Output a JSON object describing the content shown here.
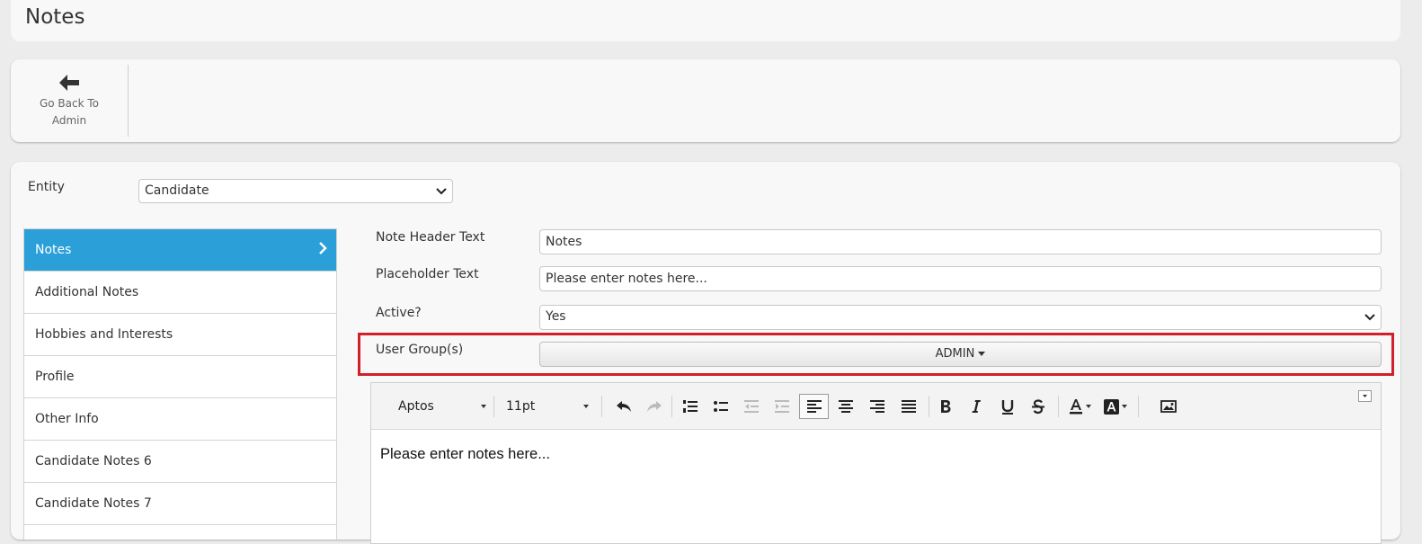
{
  "page": {
    "title": "Notes"
  },
  "toolbar": {
    "back_label": "Go Back To Admin"
  },
  "entity": {
    "label": "Entity",
    "selected": "Candidate"
  },
  "sidebar": {
    "items": [
      {
        "label": "Notes",
        "active": true
      },
      {
        "label": "Additional Notes"
      },
      {
        "label": "Hobbies and Interests"
      },
      {
        "label": "Profile"
      },
      {
        "label": "Other Info"
      },
      {
        "label": "Candidate Notes 6"
      },
      {
        "label": "Candidate Notes 7"
      }
    ]
  },
  "form": {
    "note_header_label": "Note Header Text",
    "note_header_value": "Notes",
    "placeholder_label": "Placeholder Text",
    "placeholder_value": "Please enter notes here...",
    "active_label": "Active?",
    "active_value": "Yes",
    "user_groups_label": "User Group(s)",
    "user_groups_value": "ADMIN"
  },
  "editor": {
    "font": "Aptos",
    "size": "11pt",
    "content": "Please enter notes here..."
  },
  "colors": {
    "accent": "#2a9fd8",
    "highlight": "#d0202a"
  }
}
